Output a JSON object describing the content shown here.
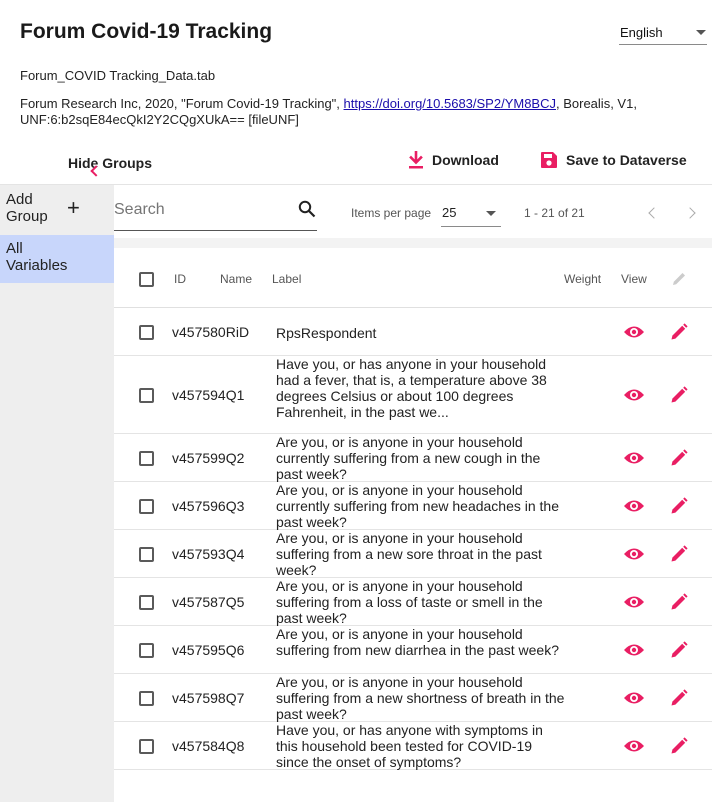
{
  "header": {
    "title": "Forum Covid-19 Tracking",
    "language": "English"
  },
  "file": {
    "name": "Forum_COVID Tracking_Data.tab",
    "citation_prefix": "Forum Research Inc, 2020, \"Forum Covid-19 Tracking\", ",
    "doi_link": "https://doi.org/10.5683/SP2/YM8BCJ",
    "citation_suffix": ", Borealis, V1, UNF:6:b2sqE84ecQkI2Y2CQgXUkA== [fileUNF]"
  },
  "toolbar": {
    "hide_groups": "Hide Groups",
    "download": "Download",
    "save": "Save to Dataverse"
  },
  "sidebar": {
    "add_group": "Add Group",
    "add_icon": "plus-icon",
    "items": [
      {
        "label": "All Variables",
        "selected": true
      }
    ]
  },
  "search": {
    "placeholder": "Search"
  },
  "pagination": {
    "items_per_page_label": "Items per page",
    "items_per_page": "25",
    "range": "1 - 21 of 21"
  },
  "table": {
    "columns": {
      "id": "ID",
      "name": "Name",
      "label": "Label",
      "weight": "Weight",
      "view": "View"
    },
    "rows": [
      {
        "id": "v457580RiD",
        "label": "RpsRespondent"
      },
      {
        "id": "v457594Q1",
        "label": "Have you, or has anyone in your household had a fever, that is, a temperature above 38 degrees Celsius or about 100 degrees Fahrenheit, in the past we..."
      },
      {
        "id": "v457599Q2",
        "label": "Are you, or is anyone in your household currently suffering from a new cough in the past week?"
      },
      {
        "id": "v457596Q3",
        "label": "Are you, or is anyone in your household currently suffering from new headaches in the past week?"
      },
      {
        "id": "v457593Q4",
        "label": "Are you, or is anyone in your household suffering from a new sore throat in the past week?"
      },
      {
        "id": "v457587Q5",
        "label": "Are you, or is anyone in your household suffering from a loss of taste or smell in the past week?"
      },
      {
        "id": "v457595Q6",
        "label": "Are you, or is anyone in your household suffering from new diarrhea in the past week?"
      },
      {
        "id": "v457598Q7",
        "label": "Are you, or is anyone in your household suffering from a new shortness of breath in the past week?"
      },
      {
        "id": "v457584Q8",
        "label": "Have you, or has anyone with symptoms in this household been tested for COVID-19 since the onset of symptoms?"
      }
    ]
  },
  "colors": {
    "accent": "#e91e63",
    "selected_bg": "#c8d6fb",
    "link": "#1a0dab"
  }
}
